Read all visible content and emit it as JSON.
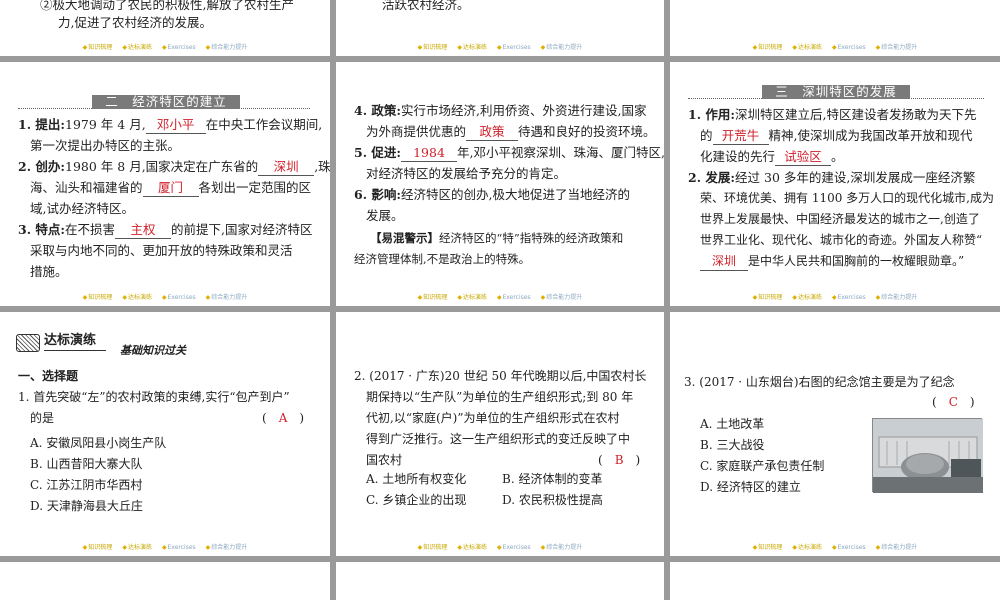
{
  "footer": [
    "知识梳理",
    "达标演练",
    "Exercises",
    "综合能力提升"
  ],
  "top_row": {
    "p1_line1": "②极大地调动了农民的积极性,解放了农村生产",
    "p1_line2": "力,促进了农村经济的发展。",
    "p2_line1": "活跃农村经济。"
  },
  "section2": {
    "title": "二　经济特区的建立",
    "item1": {
      "label": "1. 提出:",
      "pre": "1979 年 4 月,",
      "ans": "邓小平",
      "post": "在中央工作会议期间,",
      "line2": "第一次提出办特区的主张。"
    },
    "item2": {
      "label": "2. 创办:",
      "pre": "1980 年 8 月,国家决定在广东省的",
      "ans1": "深圳",
      "post1": ",珠",
      "line2_pre": "海、汕头和福建省的",
      "ans2": "厦门",
      "line2_post": "各划出一定范围的区",
      "line3": "域,试办经济特区。"
    },
    "item3": {
      "label": "3. 特点:",
      "pre": "在不损害",
      "ans": "主权",
      "post": "的前提下,国家对经济特区",
      "line2": "采取与内地不同的、更加开放的特殊政策和灵活",
      "line3": "措施。"
    }
  },
  "section2b": {
    "item4": {
      "label": "4. 政策:",
      "line1": "实行市场经济,利用侨资、外资进行建设,国家",
      "line2_pre": "为外商提供优惠的",
      "ans": "政策",
      "line2_post": "待遇和良好的投资环境。"
    },
    "item5": {
      "label": "5. 促进:",
      "ans": "1984",
      "post": "年,邓小平视察深圳、珠海、厦门特区,",
      "line2": "对经济特区的发展给予充分的肯定。"
    },
    "item6": {
      "label": "6. 影响:",
      "line1": "经济特区的创办,极大地促进了当地经济的",
      "line2": "发展。"
    },
    "warn_label": "【易混警示】",
    "warn_line1": "经济特区的“特”指特殊的经济政策和",
    "warn_line2": "经济管理体制,不是政治上的特殊。"
  },
  "section3": {
    "title": "三　深圳特区的发展",
    "item1": {
      "label": "1. 作用:",
      "line1": "深圳特区建立后,特区建设者发扬敢为天下先",
      "line2_pre": "的",
      "ans1": "开荒牛",
      "line2_post": "精神,使深圳成为我国改革开放和现代",
      "line3_pre": "化建设的先行",
      "ans2": "试验区",
      "line3_post": "。"
    },
    "item2": {
      "label": "2. 发展:",
      "line1": "经过 30 多年的建设,深圳发展成一座经济繁",
      "line2": "荣、环境优美、拥有 1100 多万人口的现代化城市,成为",
      "line3": "世界上发展最快、中国经济最发达的城市之一,创造了",
      "line4": "世界工业化、现代化、城市化的奇迹。外国友人称赞“",
      "ans": "深圳",
      "line5_post": "是中华人民共和国胸前的一枚耀眼勋章。”"
    }
  },
  "practice": {
    "title": "达标演练",
    "subtitle": "基础知识过关",
    "section": "一、选择题",
    "q1": {
      "line1": "1. 首先突破“左”的农村政策的束缚,实行“包产到户”",
      "line2": "的是",
      "answer": "A",
      "options": [
        "A. 安徽凤阳县小岗生产队",
        "B. 山西昔阳大寨大队",
        "C. 江苏江阴市华西村",
        "D. 天津静海县大丘庄"
      ]
    },
    "q2": {
      "line1": "2. (2017 · 广东)20 世纪 50 年代晚期以后,中国农村长",
      "line2": "期保持以“生产队”为单位的生产组织形式;到 80 年",
      "line3": "代初,以“家庭(户)”为单位的生产组织形式在农村",
      "line4": "得到广泛推行。这一生产组织形式的变迁反映了中",
      "line5": "国农村",
      "answer": "B",
      "options": [
        "A. 土地所有权变化",
        "B. 经济体制的变革",
        "C. 乡镇企业的出现",
        "D. 农民积极性提高"
      ]
    },
    "q3": {
      "line1": "3. (2017 · 山东烟台)右图的纪念馆主要是为了纪念",
      "answer": "C",
      "options": [
        "A. 土地改革",
        "B. 三大战役",
        "C. 家庭联产承包责任制",
        "D. 经济特区的建立"
      ]
    }
  }
}
